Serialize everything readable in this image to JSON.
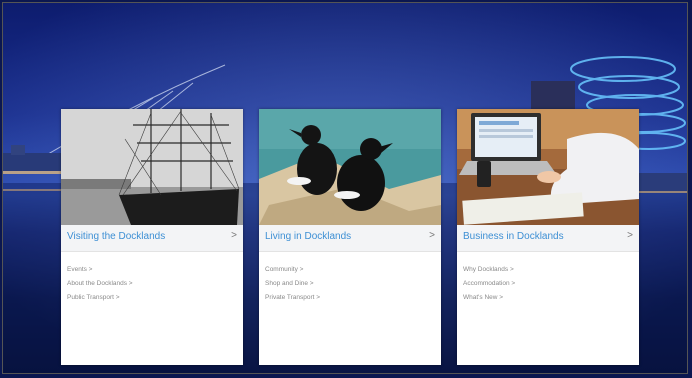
{
  "cards": [
    {
      "title": "Visiting the Docklands",
      "chevron": ">",
      "links": [
        "Events >",
        "About the Docklands >",
        "Public Transport >"
      ],
      "image": "sailing-ship-photo"
    },
    {
      "title": "Living in Docklands",
      "chevron": ">",
      "links": [
        "Community >",
        "Shop and Dine >",
        "Private Transport >"
      ],
      "image": "seabirds-photo"
    },
    {
      "title": "Business in Docklands",
      "chevron": ">",
      "links": [
        "Why Docklands >",
        "Accommodation >",
        "What's New >"
      ],
      "image": "laptop-work-photo"
    }
  ],
  "colors": {
    "accent": "#3d8fd4",
    "link": "#8a8a8a",
    "sky_top": "#0d1c6e",
    "sky_mid": "#2f4fb4"
  }
}
